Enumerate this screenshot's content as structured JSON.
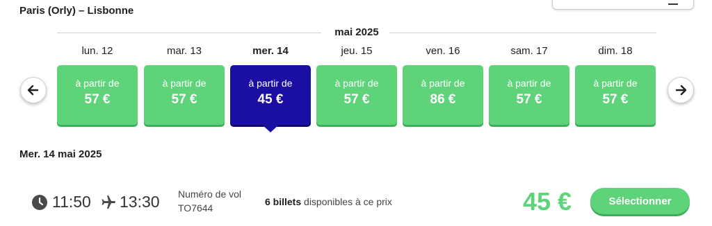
{
  "route": {
    "title": "Paris (Orly) – Lisbonne"
  },
  "calendar": {
    "month": "mai 2025",
    "days": [
      {
        "label": "lun. 12",
        "from": "à partir de",
        "price": "57 €",
        "active": false
      },
      {
        "label": "mar. 13",
        "from": "à partir de",
        "price": "57 €",
        "active": false
      },
      {
        "label": "mer. 14",
        "from": "à partir de",
        "price": "45 €",
        "active": true
      },
      {
        "label": "jeu. 15",
        "from": "à partir de",
        "price": "57 €",
        "active": false
      },
      {
        "label": "ven. 16",
        "from": "à partir de",
        "price": "86 €",
        "active": false
      },
      {
        "label": "sam. 17",
        "from": "à partir de",
        "price": "57 €",
        "active": false
      },
      {
        "label": "dim. 18",
        "from": "à partir de",
        "price": "57 €",
        "active": false
      }
    ],
    "prev_icon": "arrow-left-icon",
    "next_icon": "arrow-right-icon"
  },
  "selected": {
    "date": "Mer. 14 mai 2025"
  },
  "flight": {
    "departure": "11:50",
    "arrival": "13:30",
    "flight_number_label": "Numéro de vol",
    "flight_number": "TO7644",
    "tickets_count": "6 billets",
    "tickets_text": " disponibles à ce prix",
    "price": "45 €",
    "select_label": "Sélectionner"
  },
  "colors": {
    "green": "#5fd37a",
    "selected_blue": "#1a0fa2",
    "text": "#1f1f1f"
  }
}
